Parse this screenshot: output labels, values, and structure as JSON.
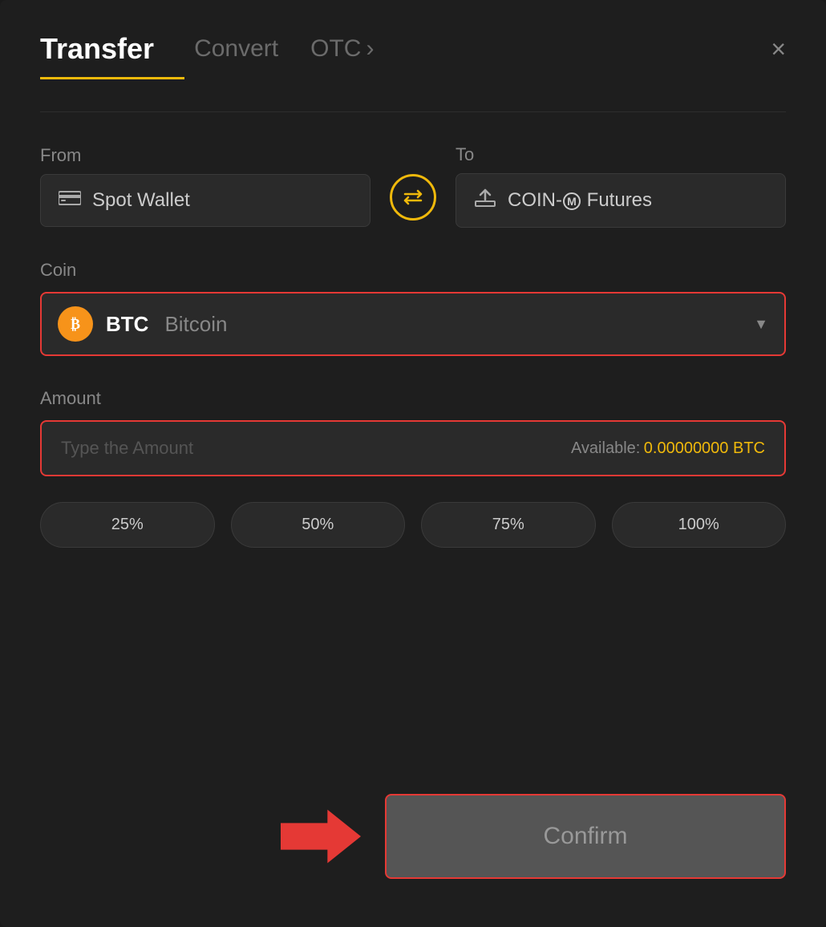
{
  "header": {
    "tab_transfer": "Transfer",
    "tab_convert": "Convert",
    "tab_otc": "OTC",
    "tab_otc_chevron": "›",
    "close_label": "×"
  },
  "from": {
    "label": "From",
    "wallet_icon": "▬",
    "wallet_text": "Spot Wallet"
  },
  "to": {
    "label": "To",
    "wallet_icon": "↑",
    "wallet_text": "COIN-Ⓜ Futures"
  },
  "swap": {
    "icon": "⇄"
  },
  "coin": {
    "label": "Coin",
    "symbol": "BTC",
    "full_name": "Bitcoin",
    "chevron": "▼"
  },
  "amount": {
    "label": "Amount",
    "placeholder": "Type the Amount",
    "available_label": "Available:",
    "available_value": "0.00000000 BTC"
  },
  "percent_buttons": [
    {
      "label": "25%"
    },
    {
      "label": "50%"
    },
    {
      "label": "75%"
    },
    {
      "label": "100%"
    }
  ],
  "confirm": {
    "label": "Confirm"
  }
}
